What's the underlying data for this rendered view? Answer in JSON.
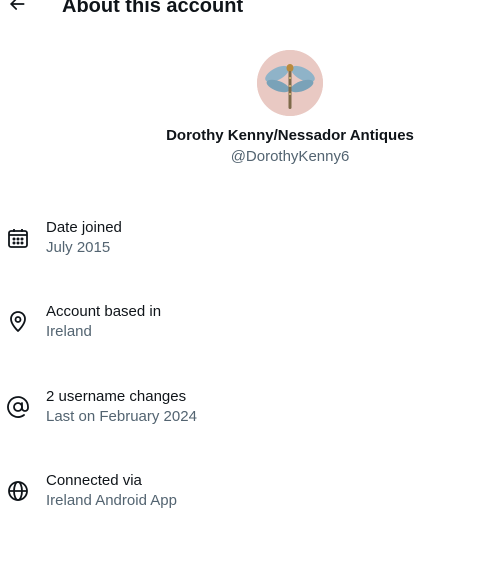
{
  "header": {
    "title": "About this account",
    "back_icon": "arrow-left-icon"
  },
  "profile": {
    "display_name": "Dorothy Kenny/Nessador Antiques",
    "handle": "@DorothyKenny6",
    "avatar_icon": "dragonfly-avatar",
    "avatar_bg": "#e9c9c3"
  },
  "details": [
    {
      "icon": "calendar-icon",
      "label": "Date joined",
      "value": "July 2015"
    },
    {
      "icon": "location-pin-icon",
      "label": "Account based in",
      "value": "Ireland"
    },
    {
      "icon": "at-sign-icon",
      "label": "2 username changes",
      "value": "Last on February 2024"
    },
    {
      "icon": "globe-icon",
      "label": "Connected via",
      "value": "Ireland Android App"
    }
  ],
  "colors": {
    "text_primary": "#0f1419",
    "text_secondary": "#536471",
    "background": "#ffffff"
  }
}
